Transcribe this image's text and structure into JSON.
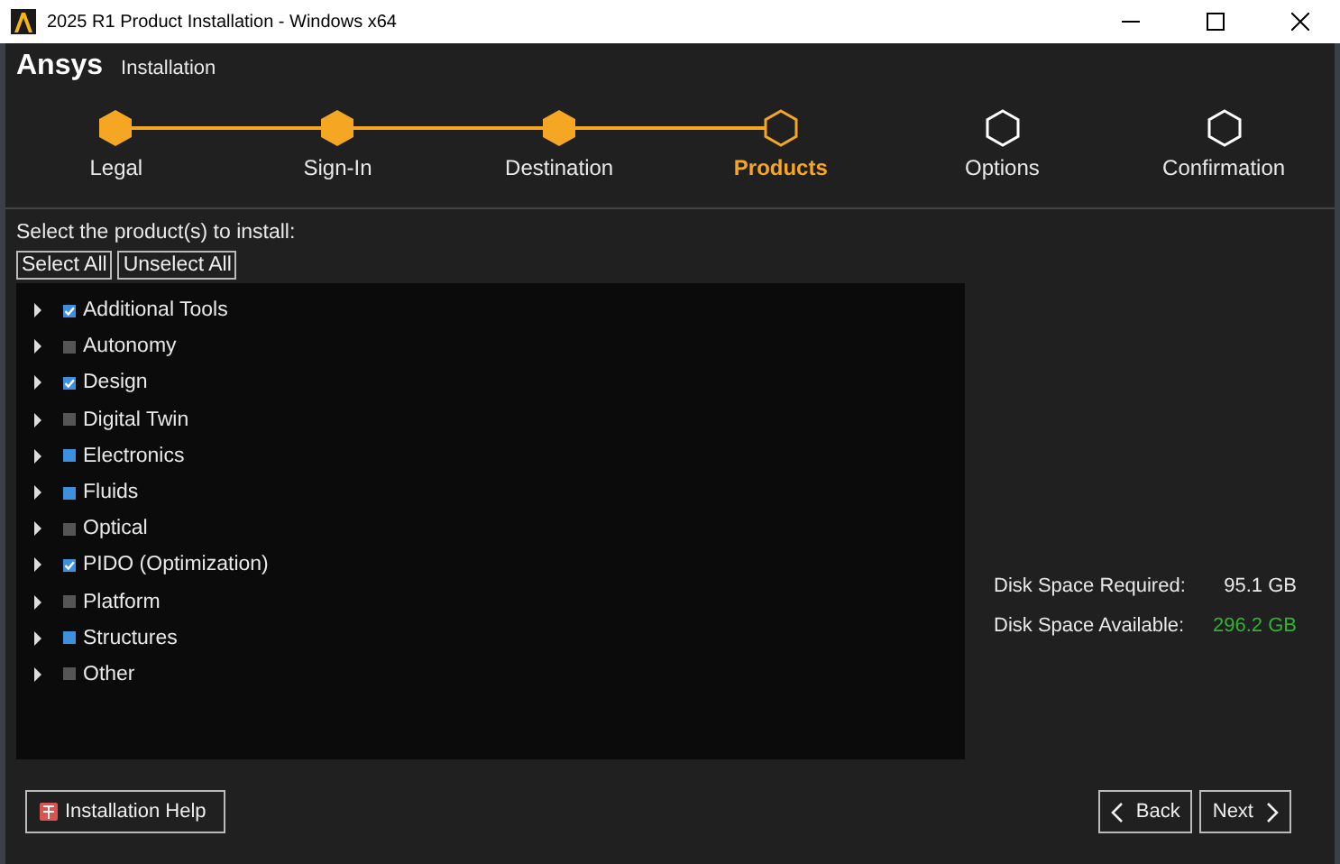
{
  "window": {
    "title": "2025 R1 Product Installation - Windows x64"
  },
  "header": {
    "brand": "Ansys",
    "subtitle": "Installation"
  },
  "steps": [
    {
      "label": "Legal",
      "done": true,
      "selected": false
    },
    {
      "label": "Sign-In",
      "done": true,
      "selected": false
    },
    {
      "label": "Destination",
      "done": true,
      "selected": false
    },
    {
      "label": "Products",
      "done": false,
      "selected": true
    },
    {
      "label": "Options",
      "done": false,
      "selected": false
    },
    {
      "label": "Confirmation",
      "done": false,
      "selected": false
    }
  ],
  "prompt": "Select the product(s) to install:",
  "select_buttons": [
    "Select All",
    "Unselect All"
  ],
  "products": [
    {
      "label": "Additional Tools",
      "checked": true,
      "partial": false
    },
    {
      "label": "Autonomy",
      "checked": false,
      "partial": false
    },
    {
      "label": "Design",
      "checked": true,
      "partial": false
    },
    {
      "label": "Digital Twin",
      "checked": false,
      "partial": false
    },
    {
      "label": "Electronics",
      "checked": false,
      "partial": true
    },
    {
      "label": "Fluids",
      "checked": false,
      "partial": true
    },
    {
      "label": "Optical",
      "checked": false,
      "partial": false
    },
    {
      "label": "PIDO (Optimization)",
      "checked": true,
      "partial": false
    },
    {
      "label": "Platform",
      "checked": false,
      "partial": false
    },
    {
      "label": "Structures",
      "checked": false,
      "partial": true
    },
    {
      "label": "Other",
      "checked": false,
      "partial": false
    }
  ],
  "disk": [
    {
      "label": "Disk Space Required:",
      "value": "95.1 GB",
      "color": "#e8e8e8"
    },
    {
      "label": "Disk Space Available:",
      "value": "296.2 GB",
      "color": "#2fb52f"
    }
  ],
  "footer": {
    "help": "Installation Help",
    "back": "Back",
    "next": "Next"
  }
}
